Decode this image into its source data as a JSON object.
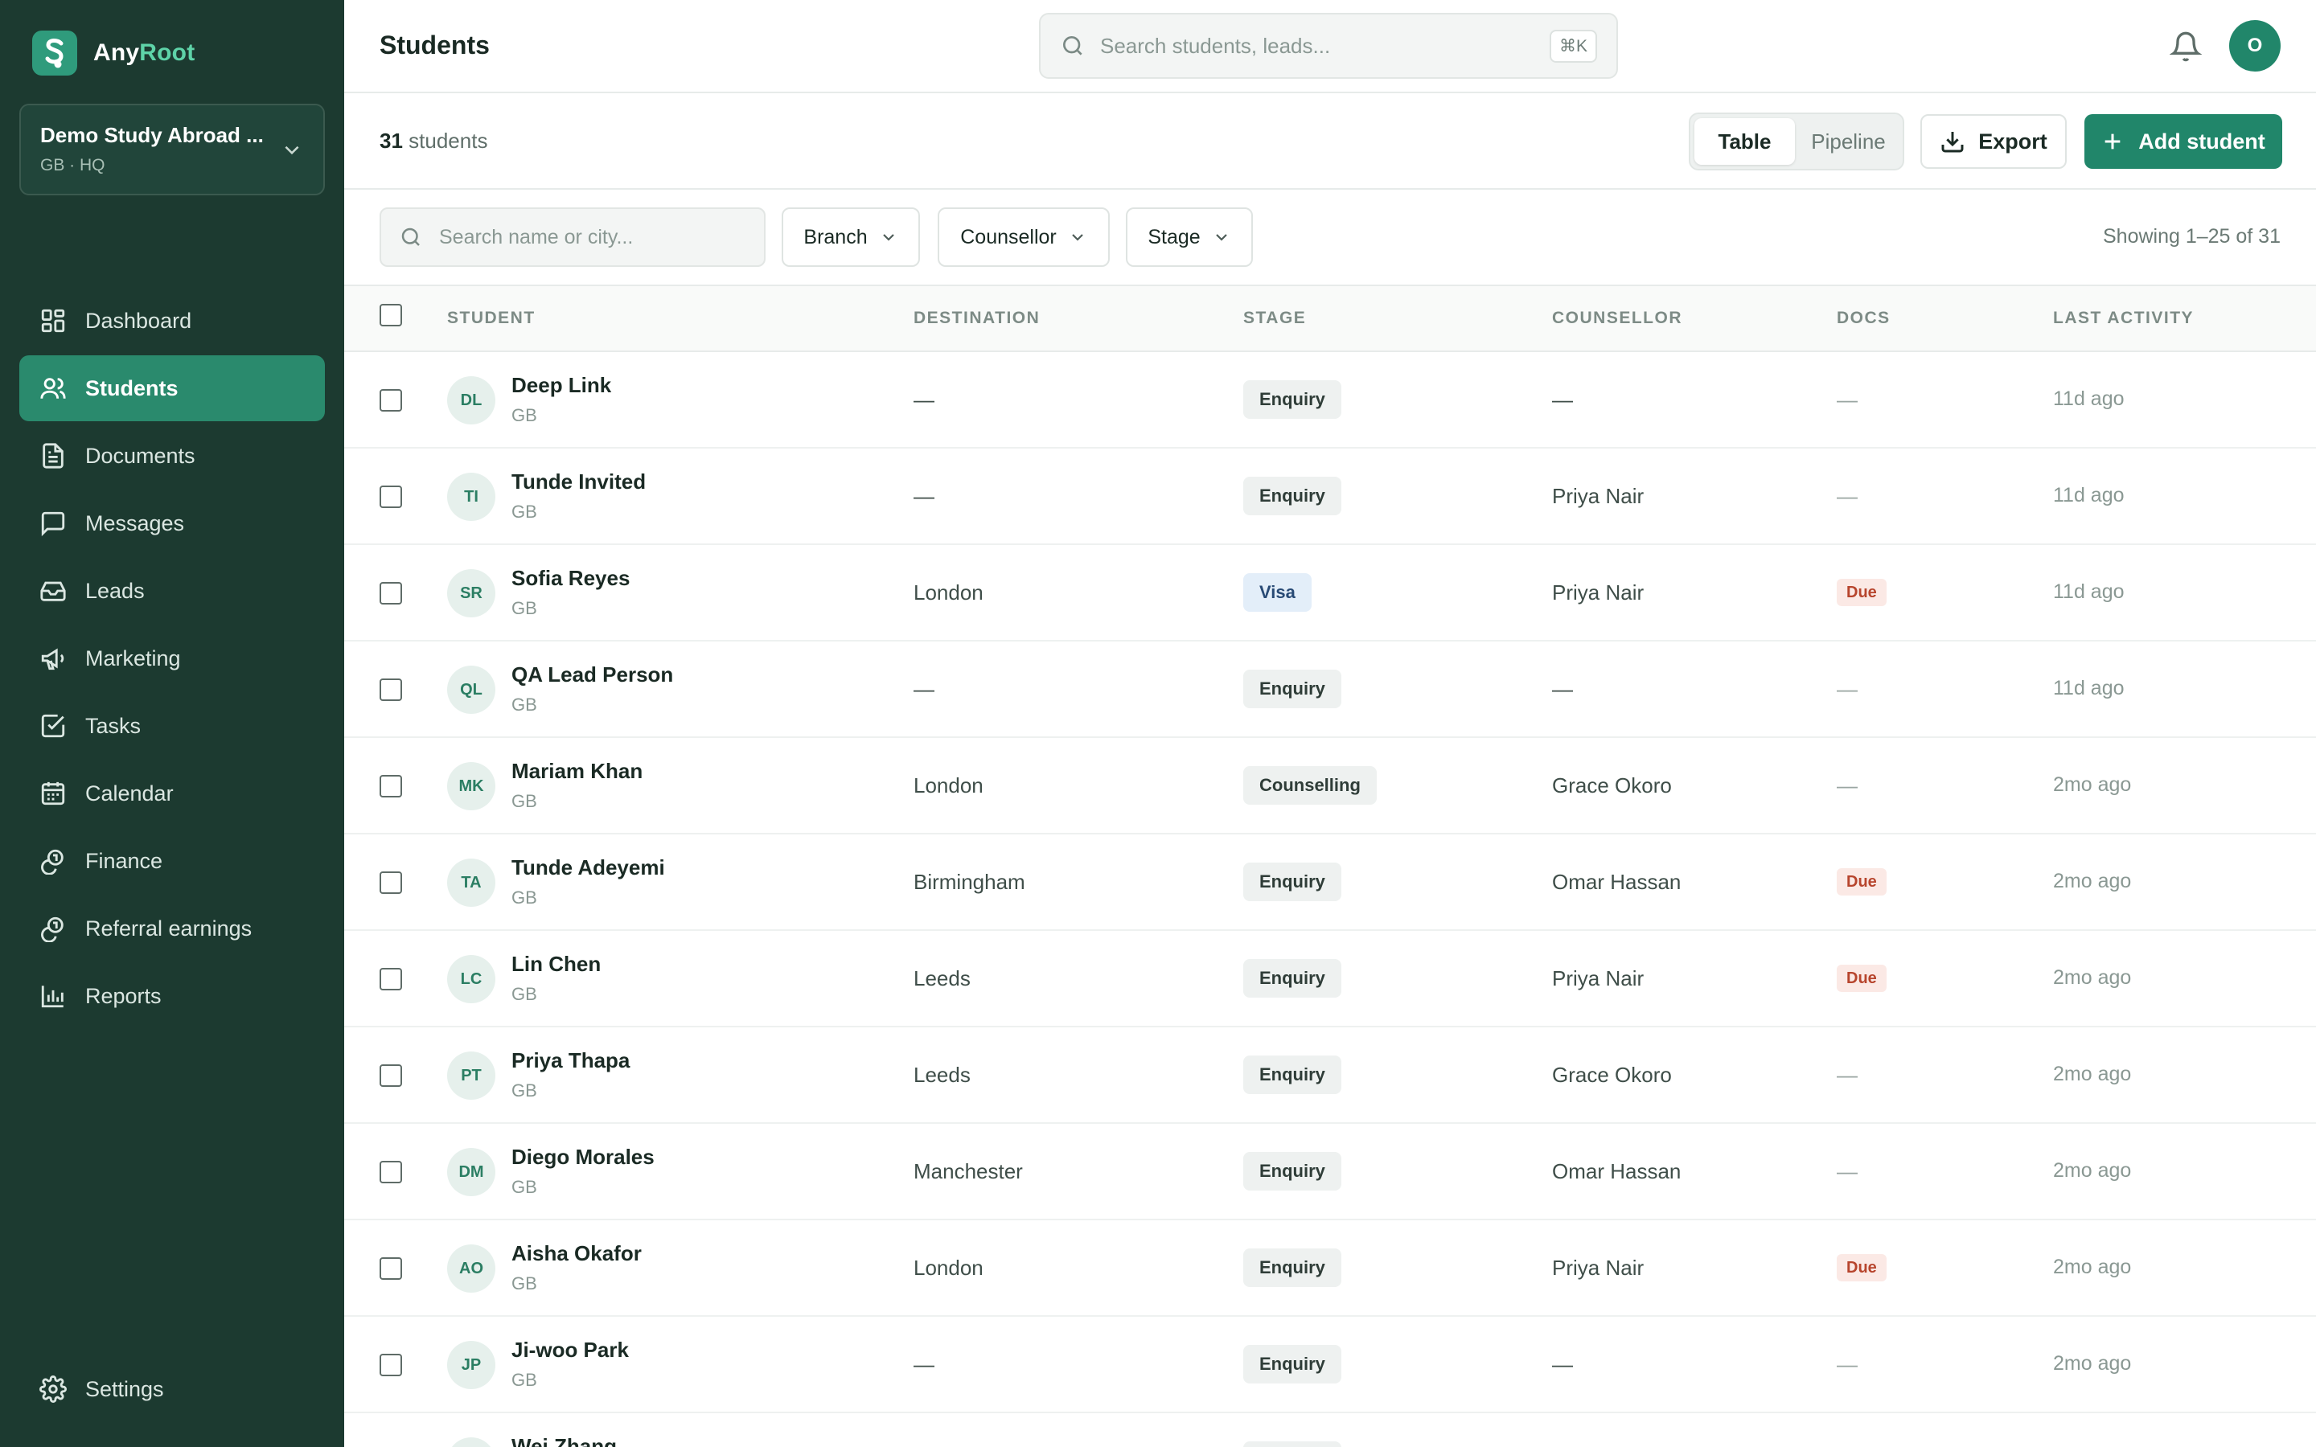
{
  "brand": {
    "name_prefix": "Any",
    "name_accent": "Root"
  },
  "org": {
    "name": "Demo Study Abroad ...",
    "sub": "GB · HQ"
  },
  "nav": [
    {
      "label": "Dashboard",
      "icon": "dashboard-icon",
      "active": false
    },
    {
      "label": "Students",
      "icon": "users-icon",
      "active": true
    },
    {
      "label": "Documents",
      "icon": "document-icon",
      "active": false
    },
    {
      "label": "Messages",
      "icon": "message-icon",
      "active": false
    },
    {
      "label": "Leads",
      "icon": "inbox-icon",
      "active": false
    },
    {
      "label": "Marketing",
      "icon": "megaphone-icon",
      "active": false
    },
    {
      "label": "Tasks",
      "icon": "checkbox-icon",
      "active": false
    },
    {
      "label": "Calendar",
      "icon": "calendar-icon",
      "active": false
    },
    {
      "label": "Finance",
      "icon": "coins-icon",
      "active": false
    },
    {
      "label": "Referral earnings",
      "icon": "coins-icon",
      "active": false
    },
    {
      "label": "Reports",
      "icon": "bar-chart-icon",
      "active": false
    }
  ],
  "settings_label": "Settings",
  "header": {
    "title": "Students",
    "search_placeholder": "Search students, leads...",
    "shortcut": "⌘K",
    "user_initial": "O"
  },
  "toolbar": {
    "count_number": "31",
    "count_label": "students",
    "view_table": "Table",
    "view_pipeline": "Pipeline",
    "export_label": "Export",
    "add_label": "Add student"
  },
  "filters": {
    "search_placeholder": "Search name or city...",
    "branch": "Branch",
    "counsellor": "Counsellor",
    "stage": "Stage",
    "showing": "Showing 1–25 of 31"
  },
  "table": {
    "columns": {
      "student": "STUDENT",
      "destination": "DESTINATION",
      "stage": "STAGE",
      "counsellor": "COUNSELLOR",
      "docs": "DOCS",
      "last_activity": "LAST ACTIVITY"
    },
    "rows": [
      {
        "initials": "DL",
        "name": "Deep Link",
        "country": "GB",
        "destination": "—",
        "stage": "Enquiry",
        "counsellor": "—",
        "docs": "—",
        "activity": "11d ago"
      },
      {
        "initials": "TI",
        "name": "Tunde Invited",
        "country": "GB",
        "destination": "—",
        "stage": "Enquiry",
        "counsellor": "Priya Nair",
        "docs": "—",
        "activity": "11d ago"
      },
      {
        "initials": "SR",
        "name": "Sofia Reyes",
        "country": "GB",
        "destination": "London",
        "stage": "Visa",
        "counsellor": "Priya Nair",
        "docs": "Due",
        "activity": "11d ago"
      },
      {
        "initials": "QL",
        "name": "QA Lead Person",
        "country": "GB",
        "destination": "—",
        "stage": "Enquiry",
        "counsellor": "—",
        "docs": "—",
        "activity": "11d ago"
      },
      {
        "initials": "MK",
        "name": "Mariam Khan",
        "country": "GB",
        "destination": "London",
        "stage": "Counselling",
        "counsellor": "Grace Okoro",
        "docs": "—",
        "activity": "2mo ago"
      },
      {
        "initials": "TA",
        "name": "Tunde Adeyemi",
        "country": "GB",
        "destination": "Birmingham",
        "stage": "Enquiry",
        "counsellor": "Omar Hassan",
        "docs": "Due",
        "activity": "2mo ago"
      },
      {
        "initials": "LC",
        "name": "Lin Chen",
        "country": "GB",
        "destination": "Leeds",
        "stage": "Enquiry",
        "counsellor": "Priya Nair",
        "docs": "Due",
        "activity": "2mo ago"
      },
      {
        "initials": "PT",
        "name": "Priya Thapa",
        "country": "GB",
        "destination": "Leeds",
        "stage": "Enquiry",
        "counsellor": "Grace Okoro",
        "docs": "—",
        "activity": "2mo ago"
      },
      {
        "initials": "DM",
        "name": "Diego Morales",
        "country": "GB",
        "destination": "Manchester",
        "stage": "Enquiry",
        "counsellor": "Omar Hassan",
        "docs": "—",
        "activity": "2mo ago"
      },
      {
        "initials": "AO",
        "name": "Aisha Okafor",
        "country": "GB",
        "destination": "London",
        "stage": "Enquiry",
        "counsellor": "Priya Nair",
        "docs": "Due",
        "activity": "2mo ago"
      },
      {
        "initials": "JP",
        "name": "Ji-woo Park",
        "country": "GB",
        "destination": "—",
        "stage": "Enquiry",
        "counsellor": "—",
        "docs": "—",
        "activity": "2mo ago"
      },
      {
        "initials": "WZ",
        "name": "Wei Zhang",
        "country": "",
        "destination": "",
        "stage": "Enquiry",
        "counsellor": "",
        "docs": "",
        "activity": ""
      }
    ]
  },
  "colors": {
    "sidebar": "#1c3a30",
    "accent": "#21866a",
    "due": "#b7452d"
  }
}
